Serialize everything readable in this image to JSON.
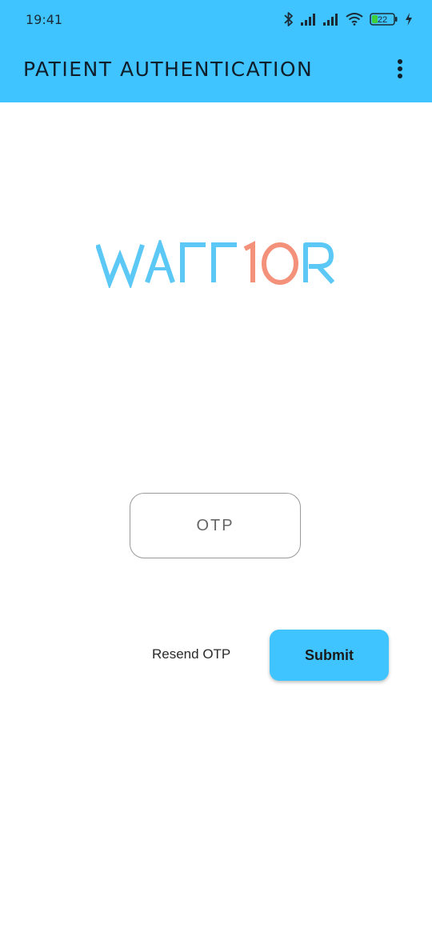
{
  "status_bar": {
    "time": "19:41",
    "battery_level": "22",
    "icons": [
      "bluetooth-icon",
      "signal-icon",
      "signal-icon",
      "wifi-icon",
      "battery-icon",
      "charging-icon"
    ]
  },
  "app_bar": {
    "title": "PATIENT AUTHENTICATION",
    "menu_icon": "more-vert-icon"
  },
  "logo": {
    "part1": "WArr",
    "part2": "10",
    "part3": "R",
    "color_primary": "#5bc8f5",
    "color_accent": "#f4917a"
  },
  "form": {
    "otp_placeholder": "OTP",
    "otp_value": ""
  },
  "actions": {
    "resend_label": "Resend OTP",
    "submit_label": "Submit"
  },
  "colors": {
    "app_bar": "#40c4ff",
    "submit_button": "#40c4ff"
  }
}
